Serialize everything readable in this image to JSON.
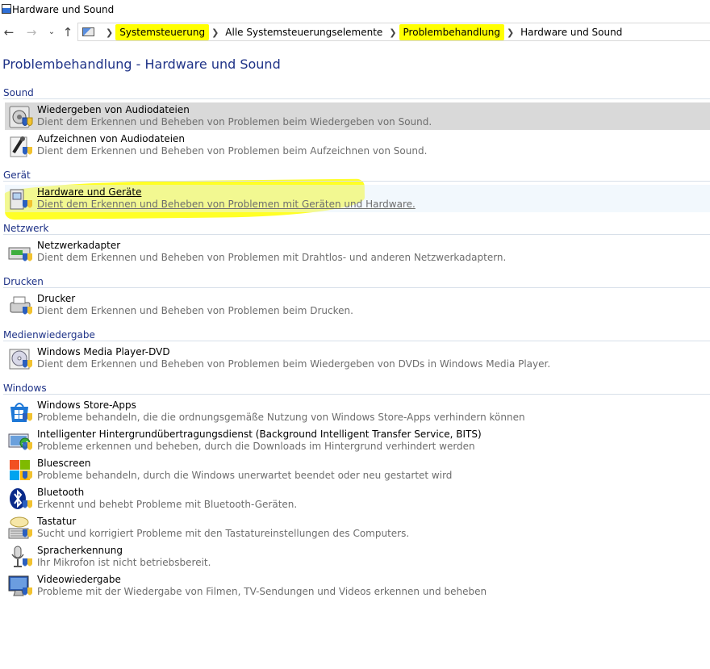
{
  "window": {
    "title": "Hardware und Sound"
  },
  "nav": {
    "back_icon": "arrow-left-icon",
    "forward_icon": "arrow-right-icon",
    "recent_icon": "chevron-down-icon",
    "up_icon": "arrow-up-icon",
    "breadcrumbs": [
      "Systemsteuerung",
      "Alle Systemsteuerungselemente",
      "Problembehandlung",
      "Hardware und Sound"
    ],
    "highlighted_crumbs": [
      "Systemsteuerung",
      "Problembehandlung"
    ]
  },
  "page": {
    "title": "Problembehandlung - Hardware und Sound"
  },
  "groups": [
    {
      "label": "Sound",
      "items": [
        {
          "name": "Wiedergeben von Audiodateien",
          "desc": "Dient dem Erkennen und Beheben von Problemen beim Wiedergeben von Sound.",
          "icon": "speaker-icon",
          "state": "selected"
        },
        {
          "name": "Aufzeichnen von Audiodateien",
          "desc": "Dient dem Erkennen und Beheben von Problemen beim Aufzeichnen von Sound.",
          "icon": "microphone-icon",
          "state": "normal"
        }
      ]
    },
    {
      "label": "Gerät",
      "items": [
        {
          "name": "Hardware und Geräte",
          "desc": "Dient dem Erkennen und Beheben von Problemen mit Geräten und Hardware.",
          "icon": "device-icon",
          "state": "hover"
        }
      ]
    },
    {
      "label": "Netzwerk",
      "items": [
        {
          "name": "Netzwerkadapter",
          "desc": "Dient dem Erkennen und Beheben von Problemen mit Drahtlos- und anderen Netzwerkadaptern.",
          "icon": "network-adapter-icon",
          "state": "normal"
        }
      ]
    },
    {
      "label": "Drucken",
      "items": [
        {
          "name": "Drucker",
          "desc": "Dient dem Erkennen und Beheben von Problemen beim Drucken.",
          "icon": "printer-icon",
          "state": "normal"
        }
      ]
    },
    {
      "label": "Medienwiedergabe",
      "items": [
        {
          "name": "Windows Media Player-DVD",
          "desc": "Dient dem Erkennen und Beheben von Problemen beim Wiedergeben von DVDs in Windows Media Player.",
          "icon": "dvd-icon",
          "state": "normal"
        }
      ]
    },
    {
      "label": "Windows",
      "items": [
        {
          "name": "Windows Store-Apps",
          "desc": "Probleme behandeln, die die ordnungsgemäße Nutzung von Windows Store-Apps verhindern können",
          "icon": "store-icon",
          "state": "normal"
        },
        {
          "name": "Intelligenter Hintergrundübertragungsdienst (Background Intelligent Transfer Service, BITS)",
          "desc": "Probleme erkennen und beheben, durch die Downloads im Hintergrund verhindert werden",
          "icon": "bits-icon",
          "state": "normal"
        },
        {
          "name": "Bluescreen",
          "desc": "Probleme behandeln, durch die Windows unerwartet beendet oder neu gestartet wird",
          "icon": "windows-logo-icon",
          "state": "normal"
        },
        {
          "name": "Bluetooth",
          "desc": "Erkennt und behebt Probleme mit Bluetooth-Geräten.",
          "icon": "bluetooth-icon",
          "state": "normal"
        },
        {
          "name": "Tastatur",
          "desc": "Sucht und korrigiert Probleme mit den Tastatureinstellungen des Computers.",
          "icon": "keyboard-icon",
          "state": "normal"
        },
        {
          "name": "Spracherkennung",
          "desc": "Ihr Mikrofon ist nicht betriebsbereit.",
          "icon": "speech-microphone-icon",
          "state": "normal"
        },
        {
          "name": "Videowiedergabe",
          "desc": "Probleme mit der Wiedergabe von Filmen, TV-Sendungen und Videos erkennen und beheben",
          "icon": "video-monitor-icon",
          "state": "normal"
        }
      ]
    }
  ],
  "colors": {
    "heading": "#1e3287",
    "description": "#6d6d6d",
    "selected_bg": "#d9d9d9",
    "hover_bg": "#e5f1fb",
    "annotation_highlight": "#ffff00"
  }
}
